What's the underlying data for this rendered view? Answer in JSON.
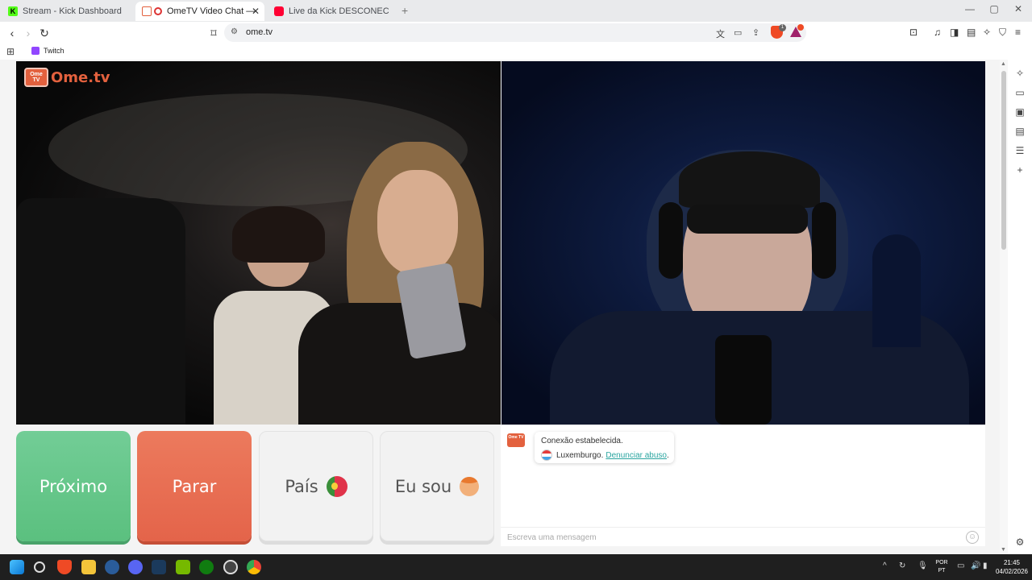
{
  "browser": {
    "tabs": [
      {
        "title": "Stream - Kick Dashboard",
        "favicon": "kick-icon",
        "color": "#53fc18"
      },
      {
        "title": "OmeTV Video Chat — Omeg",
        "favicon": "ometv-icon",
        "color": "#e3613e",
        "active": true
      },
      {
        "title": "Live da Kick DESCONECTANDO ou TI",
        "favicon": "youtube-icon",
        "color": "#ff0033"
      }
    ],
    "url": "ome.tv",
    "bookmarks": [
      {
        "label": "Twitch",
        "favicon": "twitch-icon"
      }
    ],
    "shield_badge": "1"
  },
  "page": {
    "logo": {
      "tv_text": "Ome TV",
      "brand": "Ome.tv"
    },
    "buttons": {
      "next": "Próximo",
      "stop": "Parar",
      "country": "País",
      "iam": "Eu sou"
    },
    "chat": {
      "icon_text": "Ome TV",
      "status": "Conexão estabelecida.",
      "country": "Luxemburgo.",
      "report_link": "Denunciar abuso",
      "input_placeholder": "Escreva uma mensagem"
    }
  },
  "taskbar": {
    "language": [
      "POR",
      "PT"
    ],
    "time": "21:45",
    "date": "04/02/2026"
  }
}
